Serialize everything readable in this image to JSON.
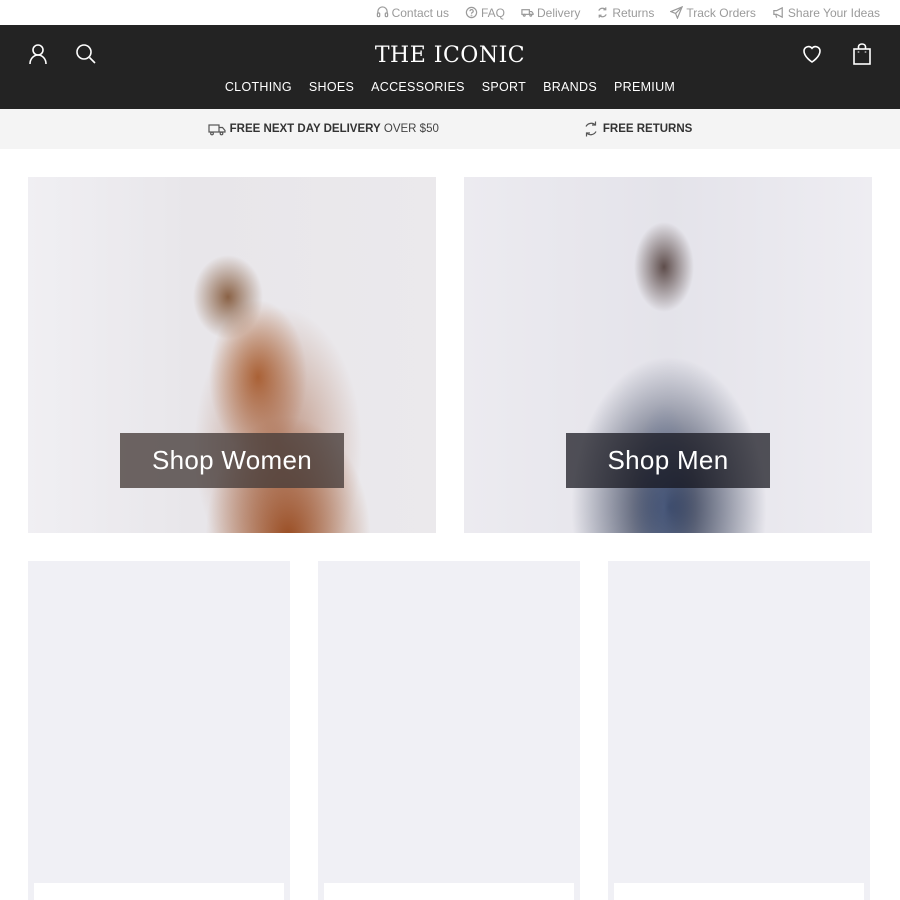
{
  "utility": {
    "links": [
      {
        "label": "Contact us",
        "icon": "headset-icon"
      },
      {
        "label": "FAQ",
        "icon": "question-icon"
      },
      {
        "label": "Delivery",
        "icon": "truck-icon"
      },
      {
        "label": "Returns",
        "icon": "returns-icon"
      },
      {
        "label": "Track Orders",
        "icon": "send-icon"
      },
      {
        "label": "Share Your Ideas",
        "icon": "megaphone-icon"
      }
    ]
  },
  "header": {
    "logo": "THE ICONIC",
    "nav": [
      "CLOTHING",
      "SHOES",
      "ACCESSORIES",
      "SPORT",
      "BRANDS",
      "PREMIUM"
    ],
    "left_icons": [
      "account-icon",
      "search-icon"
    ],
    "right_icons": [
      "wishlist-heart-icon",
      "shopping-bag-icon"
    ],
    "background": "#232323"
  },
  "promo": {
    "delivery_bold": "FREE NEXT DAY DELIVERY",
    "delivery_rest": "OVER $50",
    "returns_bold": "FREE RETURNS"
  },
  "heroes": {
    "women_cta": "Shop Women",
    "men_cta": "Shop Men"
  },
  "colors": {
    "tile_bg": "#f0f0f5",
    "promo_bg": "#f4f4f4"
  }
}
